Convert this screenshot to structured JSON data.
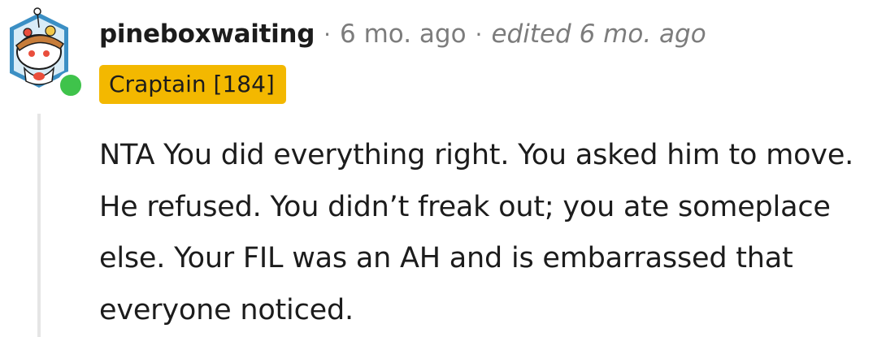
{
  "comment": {
    "username": "pineboxwaiting",
    "separator": "·",
    "timestamp": "6 mo. ago",
    "edited": "edited 6 mo. ago",
    "flair": "Craptain [184]",
    "body": "NTA You did everything right. You asked him to move. He refused. You didn’t freak out; you ate someplace else. Your FIL was an AH and is embarrassed that everyone noticed.",
    "avatar_icon": "snoo-avatar-icon",
    "online_status_color": "#3fc34b",
    "flair_color": "#f3b800"
  }
}
